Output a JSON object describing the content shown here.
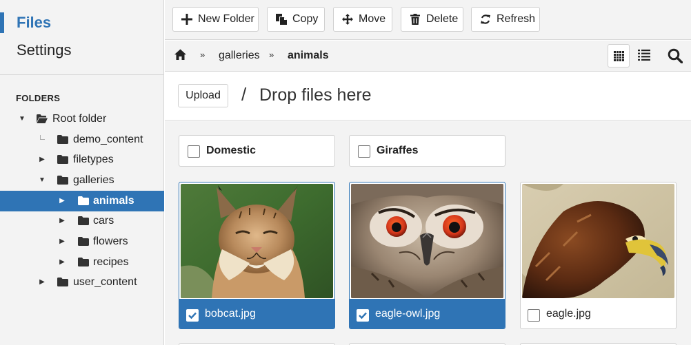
{
  "sidebar": {
    "nav": {
      "files": "Files",
      "settings": "Settings"
    },
    "folders_heading": "FOLDERS",
    "tree": [
      {
        "name": "Root folder",
        "toggle": "expanded"
      },
      {
        "name": "demo_content",
        "toggle": "none"
      },
      {
        "name": "filetypes",
        "toggle": "collapsed"
      },
      {
        "name": "galleries",
        "toggle": "expanded"
      },
      {
        "name": "animals",
        "toggle": "collapsed",
        "selected": true
      },
      {
        "name": "cars",
        "toggle": "collapsed"
      },
      {
        "name": "flowers",
        "toggle": "collapsed"
      },
      {
        "name": "recipes",
        "toggle": "collapsed"
      },
      {
        "name": "user_content",
        "toggle": "collapsed"
      }
    ]
  },
  "toolbar": {
    "new_folder": "New Folder",
    "copy": "Copy",
    "move": "Move",
    "delete": "Delete",
    "refresh": "Refresh"
  },
  "breadcrumb": {
    "separator": "»",
    "items": [
      "galleries",
      "animals"
    ]
  },
  "view": {
    "mode": "grid"
  },
  "upload": {
    "button": "Upload",
    "slash": "/",
    "drop_text": "Drop files here"
  },
  "folders": [
    {
      "name": "Domestic",
      "checked": false
    },
    {
      "name": "Giraffes",
      "checked": false
    }
  ],
  "files": [
    {
      "name": "bobcat.jpg",
      "checked": true
    },
    {
      "name": "eagle-owl.jpg",
      "checked": true
    },
    {
      "name": "eagle.jpg",
      "checked": false
    }
  ],
  "colors": {
    "accent": "#2f74b5",
    "panel": "#f3f3f3",
    "border": "#cfcfcf"
  },
  "icons": {
    "toolbar": [
      "plus-icon",
      "copy-icon",
      "move-icon",
      "trash-icon",
      "refresh-icon"
    ],
    "breadcrumb": "home-icon",
    "views": [
      "grid-view-icon",
      "list-view-icon",
      "search-icon"
    ],
    "tree": "folder-icon"
  }
}
